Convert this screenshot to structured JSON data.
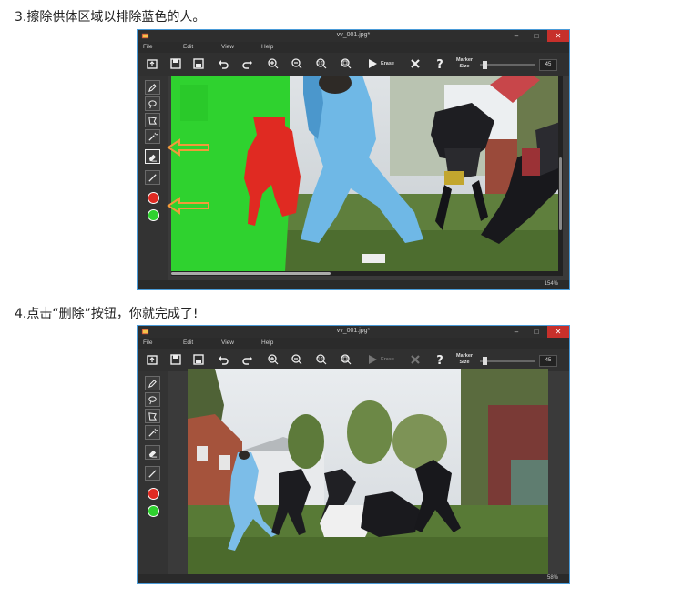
{
  "steps": {
    "step3": "3.擦除供体区域以排除蓝色的人。",
    "step4": "4.点击“删除”按钮，你就完成了!"
  },
  "window1": {
    "title": "vv_001.jpg*",
    "menu": [
      "File",
      "Edit",
      "View",
      "Help"
    ],
    "erase_label": "Erase",
    "marker_label_1": "Marker",
    "marker_label_2": "Size",
    "marker_value": "45",
    "marker_fraction": 0.05,
    "zoom": "154%"
  },
  "window2": {
    "title": "vv_001.jpg*",
    "menu": [
      "File",
      "Edit",
      "View",
      "Help"
    ],
    "erase_label": "Erase",
    "marker_label_1": "Marker",
    "marker_label_2": "Size",
    "marker_value": "45",
    "marker_fraction": 0.05,
    "zoom": "58%"
  },
  "colors": {
    "accent_border": "#4a9bd8",
    "green_mask": "#2fd22f",
    "red_mask": "#e02a22",
    "arrow_orange": "#f29a3a",
    "close_button": "#c7302b"
  },
  "icons": {
    "toolbar": [
      "open-icon",
      "save-icon",
      "save-as-icon",
      "undo-icon",
      "redo-icon",
      "zoom-in-icon",
      "zoom-out-icon",
      "zoom-100-icon",
      "zoom-fit-icon",
      "play-icon",
      "clear-icon",
      "help-icon"
    ],
    "tools": [
      "marker-icon",
      "lasso-icon",
      "polygon-lasso-icon",
      "magic-wand-icon",
      "eraser-icon",
      "line-icon",
      "red-marker-dot",
      "green-marker-dot"
    ]
  }
}
